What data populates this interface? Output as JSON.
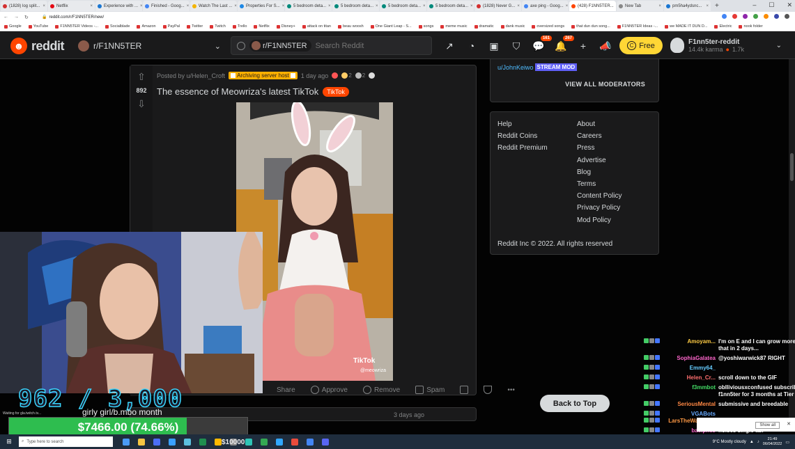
{
  "browser": {
    "tabs": [
      {
        "label": "(1828) log split...",
        "color": "#d32f2f"
      },
      {
        "label": "Netflix",
        "color": "#e50914"
      },
      {
        "label": "Experience with ...",
        "color": "#1976d2"
      },
      {
        "label": "Finished - Goog...",
        "color": "#4285f4"
      },
      {
        "label": "Watch The Last ...",
        "color": "#f4b400"
      },
      {
        "label": "Properties For S...",
        "color": "#1e88e5"
      },
      {
        "label": "5 bedroom deta...",
        "color": "#00897b"
      },
      {
        "label": "5 bedroom deta...",
        "color": "#00897b"
      },
      {
        "label": "5 bedroom deta...",
        "color": "#00897b"
      },
      {
        "label": "5 bedroom deta...",
        "color": "#00897b"
      },
      {
        "label": "(1828) Never G...",
        "color": "#d32f2f"
      },
      {
        "label": "axe ping - Goog...",
        "color": "#4285f4"
      },
      {
        "label": "(428) F1NN5TER...",
        "color": "#ff4500",
        "active": true
      },
      {
        "label": "New Tab",
        "color": "#888888"
      },
      {
        "label": "pm5ha4ydsnc...",
        "color": "#1976d2"
      }
    ],
    "url": "reddit.com/r/F1NN5TER/new/",
    "bookmarks": [
      "Google",
      "YouTube",
      "F1NN5TER Videos -...",
      "Socialblade",
      "Amazon",
      "PayPal",
      "Twitter",
      "Twitch",
      "Trello",
      "Netflix",
      "Disney+",
      "attack on titan",
      "beau woosh",
      "One Giant Leap - S...",
      "songs",
      "meme music",
      "dramatic",
      "dank music",
      "oversized songs",
      "that dun dun song...",
      "F1NN5TER Ideas -...",
      "we MADE IT DUN D...",
      "Electric",
      "nook folder"
    ]
  },
  "header": {
    "logo_text": "reddit",
    "subreddit": "r/F1NN5TER",
    "search_pill": "r/F1NN5TER",
    "search_placeholder": "Search Reddit",
    "chat_badge": "161",
    "notif_badge": "267",
    "free_label": "Free",
    "username": "F1nn5ter-reddit",
    "karma": "14.4k karma",
    "coins": "1.7k"
  },
  "post": {
    "votes": "892",
    "posted_by": "Posted by u/Helen_Croft",
    "user_flair": "Archiving server host",
    "time": "1 day ago",
    "award_counts": [
      "2",
      "2"
    ],
    "title": "The essence of Meowriza's latest TikTok",
    "flair": "TikTok",
    "watermark": "TikTok",
    "watermark_user": "@meowriza",
    "actions": [
      "Share",
      "Approve",
      "Remove",
      "Spam"
    ],
    "next_post_time": "3 days ago"
  },
  "sidebar": {
    "moderator": "u/JohnKeiwo",
    "moderator_flair": "STREAM MOD",
    "view_all": "VIEW ALL MODERATORS",
    "links_left": [
      "Help",
      "Reddit Coins",
      "Reddit Premium"
    ],
    "links_right": [
      "About",
      "Careers",
      "Press",
      "Advertise",
      "Blog",
      "Terms",
      "Content Policy",
      "Privacy Policy",
      "Mod Policy"
    ],
    "copyright": "Reddit Inc © 2022. All rights reserved",
    "back_to_top": "Back to Top"
  },
  "stream": {
    "sub_counter": "962 / 3,000",
    "goal_label": "girly girl/b.mbo month",
    "progress_text": "$7466.00 (74.66%)",
    "progress_fraction": 0.7466,
    "below_amount": "$10000",
    "loading_text": "Waiting for gla.twitch.tv...",
    "chat": [
      {
        "user": "Amoyam...",
        "color": "#ffcc44",
        "text": "I'm on E and I can grow more than",
        "cont": "that in 2 days..."
      },
      {
        "user": "SophiaGalatea",
        "color": "#ff66cc",
        "text": "@yoshiwarwick87 RIGHT"
      },
      {
        "user": "Emmy64_",
        "color": "#66ccff",
        "text": ""
      },
      {
        "user": "Helen_Cr...",
        "color": "#ff6f6f",
        "text": "scroll down to the GIF"
      },
      {
        "user": "f3mmbot",
        "color": "#44dd66",
        "text": "oblliviousxconfused subscribed to",
        "cont": "f1nn5ter for 3 months at Tier 1!"
      },
      {
        "user": "SeriousMental",
        "color": "#ff8844",
        "text": "submissive and breedable"
      },
      {
        "user": "VGABots",
        "color": "#66aaff",
        "text": ""
      },
      {
        "user": "LarsTheWanderer",
        "color": "#ff9944",
        "text": "Smrt"
      },
      {
        "user": "baelphes",
        "color": "#ff66cc",
        "text": "noises single tax"
      }
    ]
  },
  "taskbar": {
    "search_placeholder": "Type here to search",
    "weather": "9°C  Mostly cloudy",
    "time": "21:49",
    "date": "06/04/2022",
    "show_all": "Show all"
  }
}
